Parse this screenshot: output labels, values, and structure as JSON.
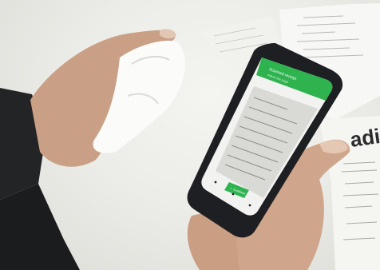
{
  "photo": {
    "subject": "hands holding a smartphone scanning a paper receipt",
    "receipt_background_text": "adiu",
    "phone_screen": {
      "app_header_title": "Scanned receipt",
      "app_header_subtitle": "Adjust the page",
      "action_button_label": "✓ Continue",
      "accent_color": "#2eb34f"
    },
    "colors": {
      "table": "#ecece8",
      "skin": "#c9a085",
      "sleeve": "#232426",
      "phone_body": "#1e1f22"
    }
  }
}
